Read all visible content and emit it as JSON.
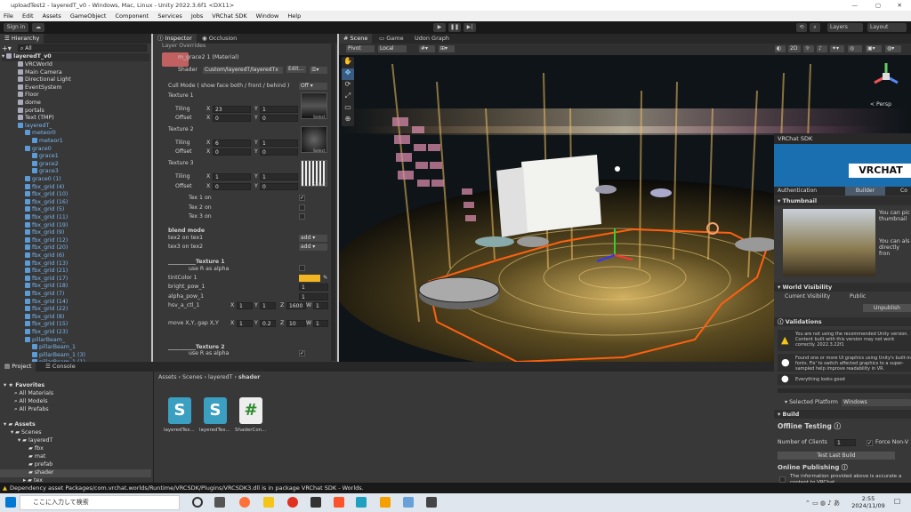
{
  "window": {
    "title": "uploadTest2 - layeredT_v0 - Windows, Mac, Linux - Unity 2022.3.6f1 <DX11>"
  },
  "menubar": {
    "items": [
      "File",
      "Edit",
      "Assets",
      "GameObject",
      "Component",
      "Services",
      "Jobs",
      "VRChat SDK",
      "Window",
      "Help"
    ]
  },
  "toolbar": {
    "sign_in": "Sign in",
    "layers": "Layers",
    "layout": "Layout"
  },
  "hierarchy": {
    "tab": "Hierarchy",
    "search": "All",
    "scene": "layeredT_v0",
    "items": [
      "VRCWorld",
      "Main Camera",
      "Directional Light",
      "EventSystem",
      "Floor",
      "dome",
      "portals",
      "Text (TMP)",
      "layeredT_",
      "meteor0",
      "meteor1",
      "grace0",
      "grace1",
      "grace2",
      "grace3",
      "grace0 (1)",
      "fbx_grid (4)",
      "fbx_grid (10)",
      "fbx_grid (16)",
      "fbx_grid (5)",
      "fbx_grid (11)",
      "fbx_grid (19)",
      "fbx_grid (9)",
      "fbx_grid (12)",
      "fbx_grid (20)",
      "fbx_grid (6)",
      "fbx_grid (13)",
      "fbx_grid (21)",
      "fbx_grid (17)",
      "fbx_grid (18)",
      "fbx_grid (7)",
      "fbx_grid (14)",
      "fbx_grid (22)",
      "fbx_grid (8)",
      "fbx_grid (15)",
      "fbx_grid (23)",
      "pillarBeam_",
      "pillarBeam_1",
      "pillarBeam_1 (3)",
      "pillarBeam_1 (1)"
    ]
  },
  "inspector": {
    "tab1": "Inspector",
    "tab2": "Occlusion",
    "header": "Layer Overrides",
    "material": "m_grace2 1 (Material)",
    "shader_label": "Shader",
    "shader_value": "Custom/layeredT/layeredTx",
    "edit": "Edit...",
    "cull_label": "Cull Mode  ( show face  both / front / behind  )",
    "cull_value": "Off",
    "tex1": "Texture 1",
    "tex2": "Texture 2",
    "tex3": "Texture 3",
    "tiling": "Tiling",
    "offset": "Offset",
    "select": "Select",
    "x": "X",
    "y": "Y",
    "z": "Z",
    "w": "W",
    "t1_tiling_x": "23",
    "t1_tiling_y": "1",
    "t1_offset_x": "0",
    "t1_offset_y": "0",
    "t2_tiling_x": "6",
    "t2_tiling_y": "1",
    "t2_offset_x": "0",
    "t2_offset_y": "0",
    "t3_tiling_x": "1",
    "t3_tiling_y": "1",
    "t3_offset_x": "0",
    "t3_offset_y": "0",
    "tex1_on": "Tex 1   on",
    "tex2_on": "Tex 2   on",
    "tex3_on": "Tex 3   on",
    "blend_mode": "blend mode",
    "tex2_on_tex1": "tex2 on tex1",
    "tex3_on_tex2": "tex3 on tex2",
    "add": "add",
    "texture1_hdr": "__________Texture 1",
    "use_r": "use R as alpha",
    "tint": "tintColor 1",
    "bright": "bright_pow_1",
    "bright_v": "1",
    "alpha": "alpha_pow_1",
    "alpha_v": "1",
    "hsv": "hsv_a_ctl_1",
    "hsv_x": "1",
    "hsv_y": "1",
    "hsv_z": "1600",
    "hsv_w": "1",
    "move": "move X,Y, gap X,Y",
    "move_x": "1",
    "move_y": "0.2",
    "move_z": "10",
    "move_w": "1",
    "texture2_hdr": "__________Texture 2",
    "use_r2": "use R as alpha"
  },
  "scene": {
    "tab1": "Scene",
    "tab2": "Game",
    "tab3": "Udon Graph",
    "pivot": "Pivot",
    "local": "Local",
    "persp": "< Persp",
    "mode2d": "2D"
  },
  "sdk": {
    "title": "VRChat SDK",
    "logo": "VRCHAT",
    "tabs": [
      "Authentication",
      "Builder",
      "Co"
    ],
    "thumbnail": "Thumbnail",
    "can_pick": "You can pic thumbnail",
    "can_also": "You can als directly fron",
    "visibility": "World Visibility",
    "current_vis": "Current Visibility",
    "public": "Public",
    "unpublish": "Unpublish",
    "validations": "Validations",
    "warn1": "You are not using the recommended Unity version. Content built with this version may not work correctly. 2022.3.22f1",
    "warn2": "Found one or more UI graphics using Unity's built-in fonts. Fix' to switch affected graphics to a super-sampled help improve readability in VR.",
    "good": "Everything looks good",
    "platform_label": "Selected Platform",
    "platform": "Windows",
    "build": "Build",
    "offline": "Offline Testing",
    "clients_label": "Number of Clients",
    "clients": "1",
    "force": "Force Non-V",
    "test_build": "Test Last Build",
    "online": "Online Publishing",
    "info": "The information provided above is accurate a content to VRChat"
  },
  "project": {
    "tab1": "Project",
    "tab2": "Console",
    "favorites": "Favorites",
    "fav_items": [
      "All Materials",
      "All Models",
      "All Prefabs"
    ],
    "assets": "Assets",
    "tree": [
      "Scenes",
      "layeredT",
      "fbx",
      "mat",
      "prefab",
      "shader",
      "tex",
      "..."
    ],
    "path": [
      "Assets",
      "Scenes",
      "layeredT",
      "shader"
    ],
    "files": [
      "layeredTex...",
      "layeredTex...",
      "ShaderCon..."
    ]
  },
  "status": {
    "message": "Dependency asset Packages/com.vrchat.worlds/Runtime/VRCSDK/Plugins/VRCSDK3.dll is in package VRChat SDK - Worlds."
  },
  "taskbar": {
    "search": "ここに入力して検索",
    "time": "2:55",
    "date": "2024/11/09"
  }
}
